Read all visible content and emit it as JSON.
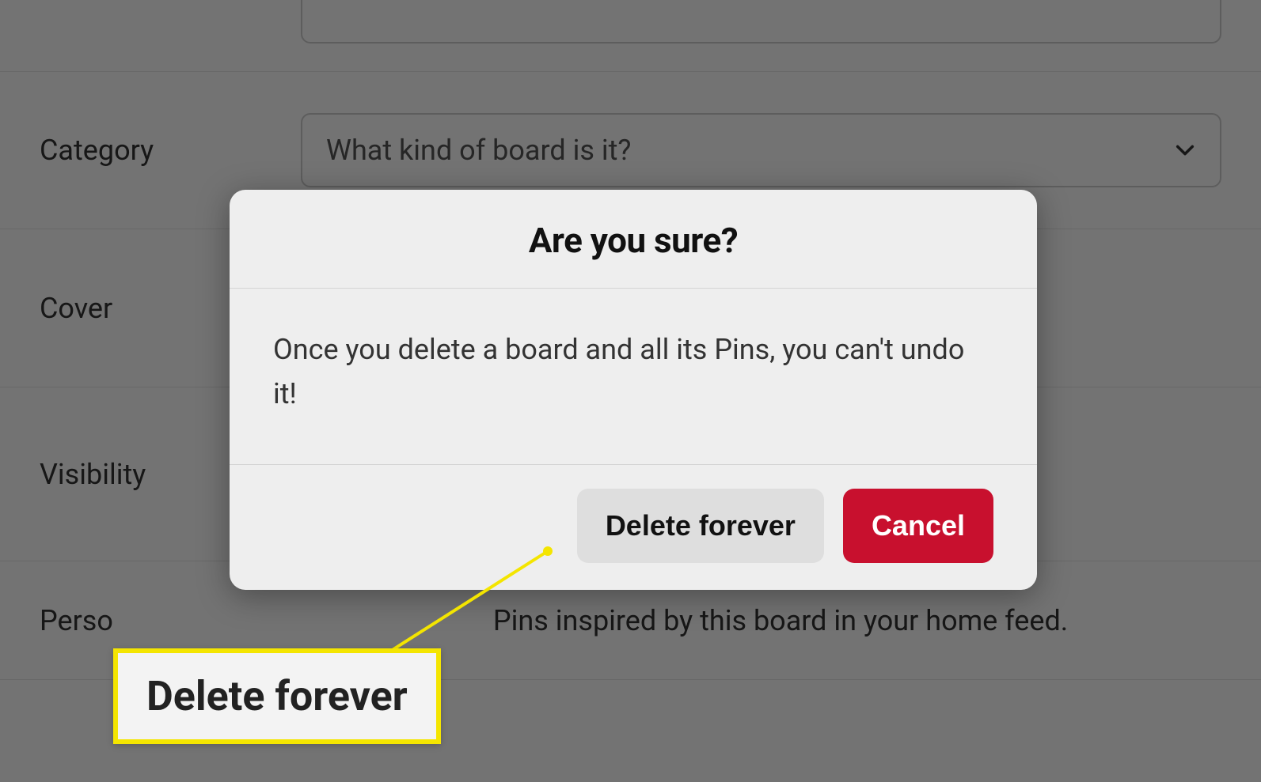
{
  "form": {
    "category": {
      "label": "Category",
      "placeholder": "What kind of board is it?"
    },
    "cover": {
      "label": "Cover"
    },
    "visibility": {
      "label": "Visibility"
    },
    "personalization": {
      "label_prefix": "Perso",
      "description_suffix": "Pins inspired by this board in your home feed."
    }
  },
  "dialog": {
    "title": "Are you sure?",
    "body": "Once you delete a board and all its Pins, you can't undo it!",
    "delete_label": "Delete forever",
    "cancel_label": "Cancel"
  },
  "callout": {
    "text": "Delete forever"
  }
}
